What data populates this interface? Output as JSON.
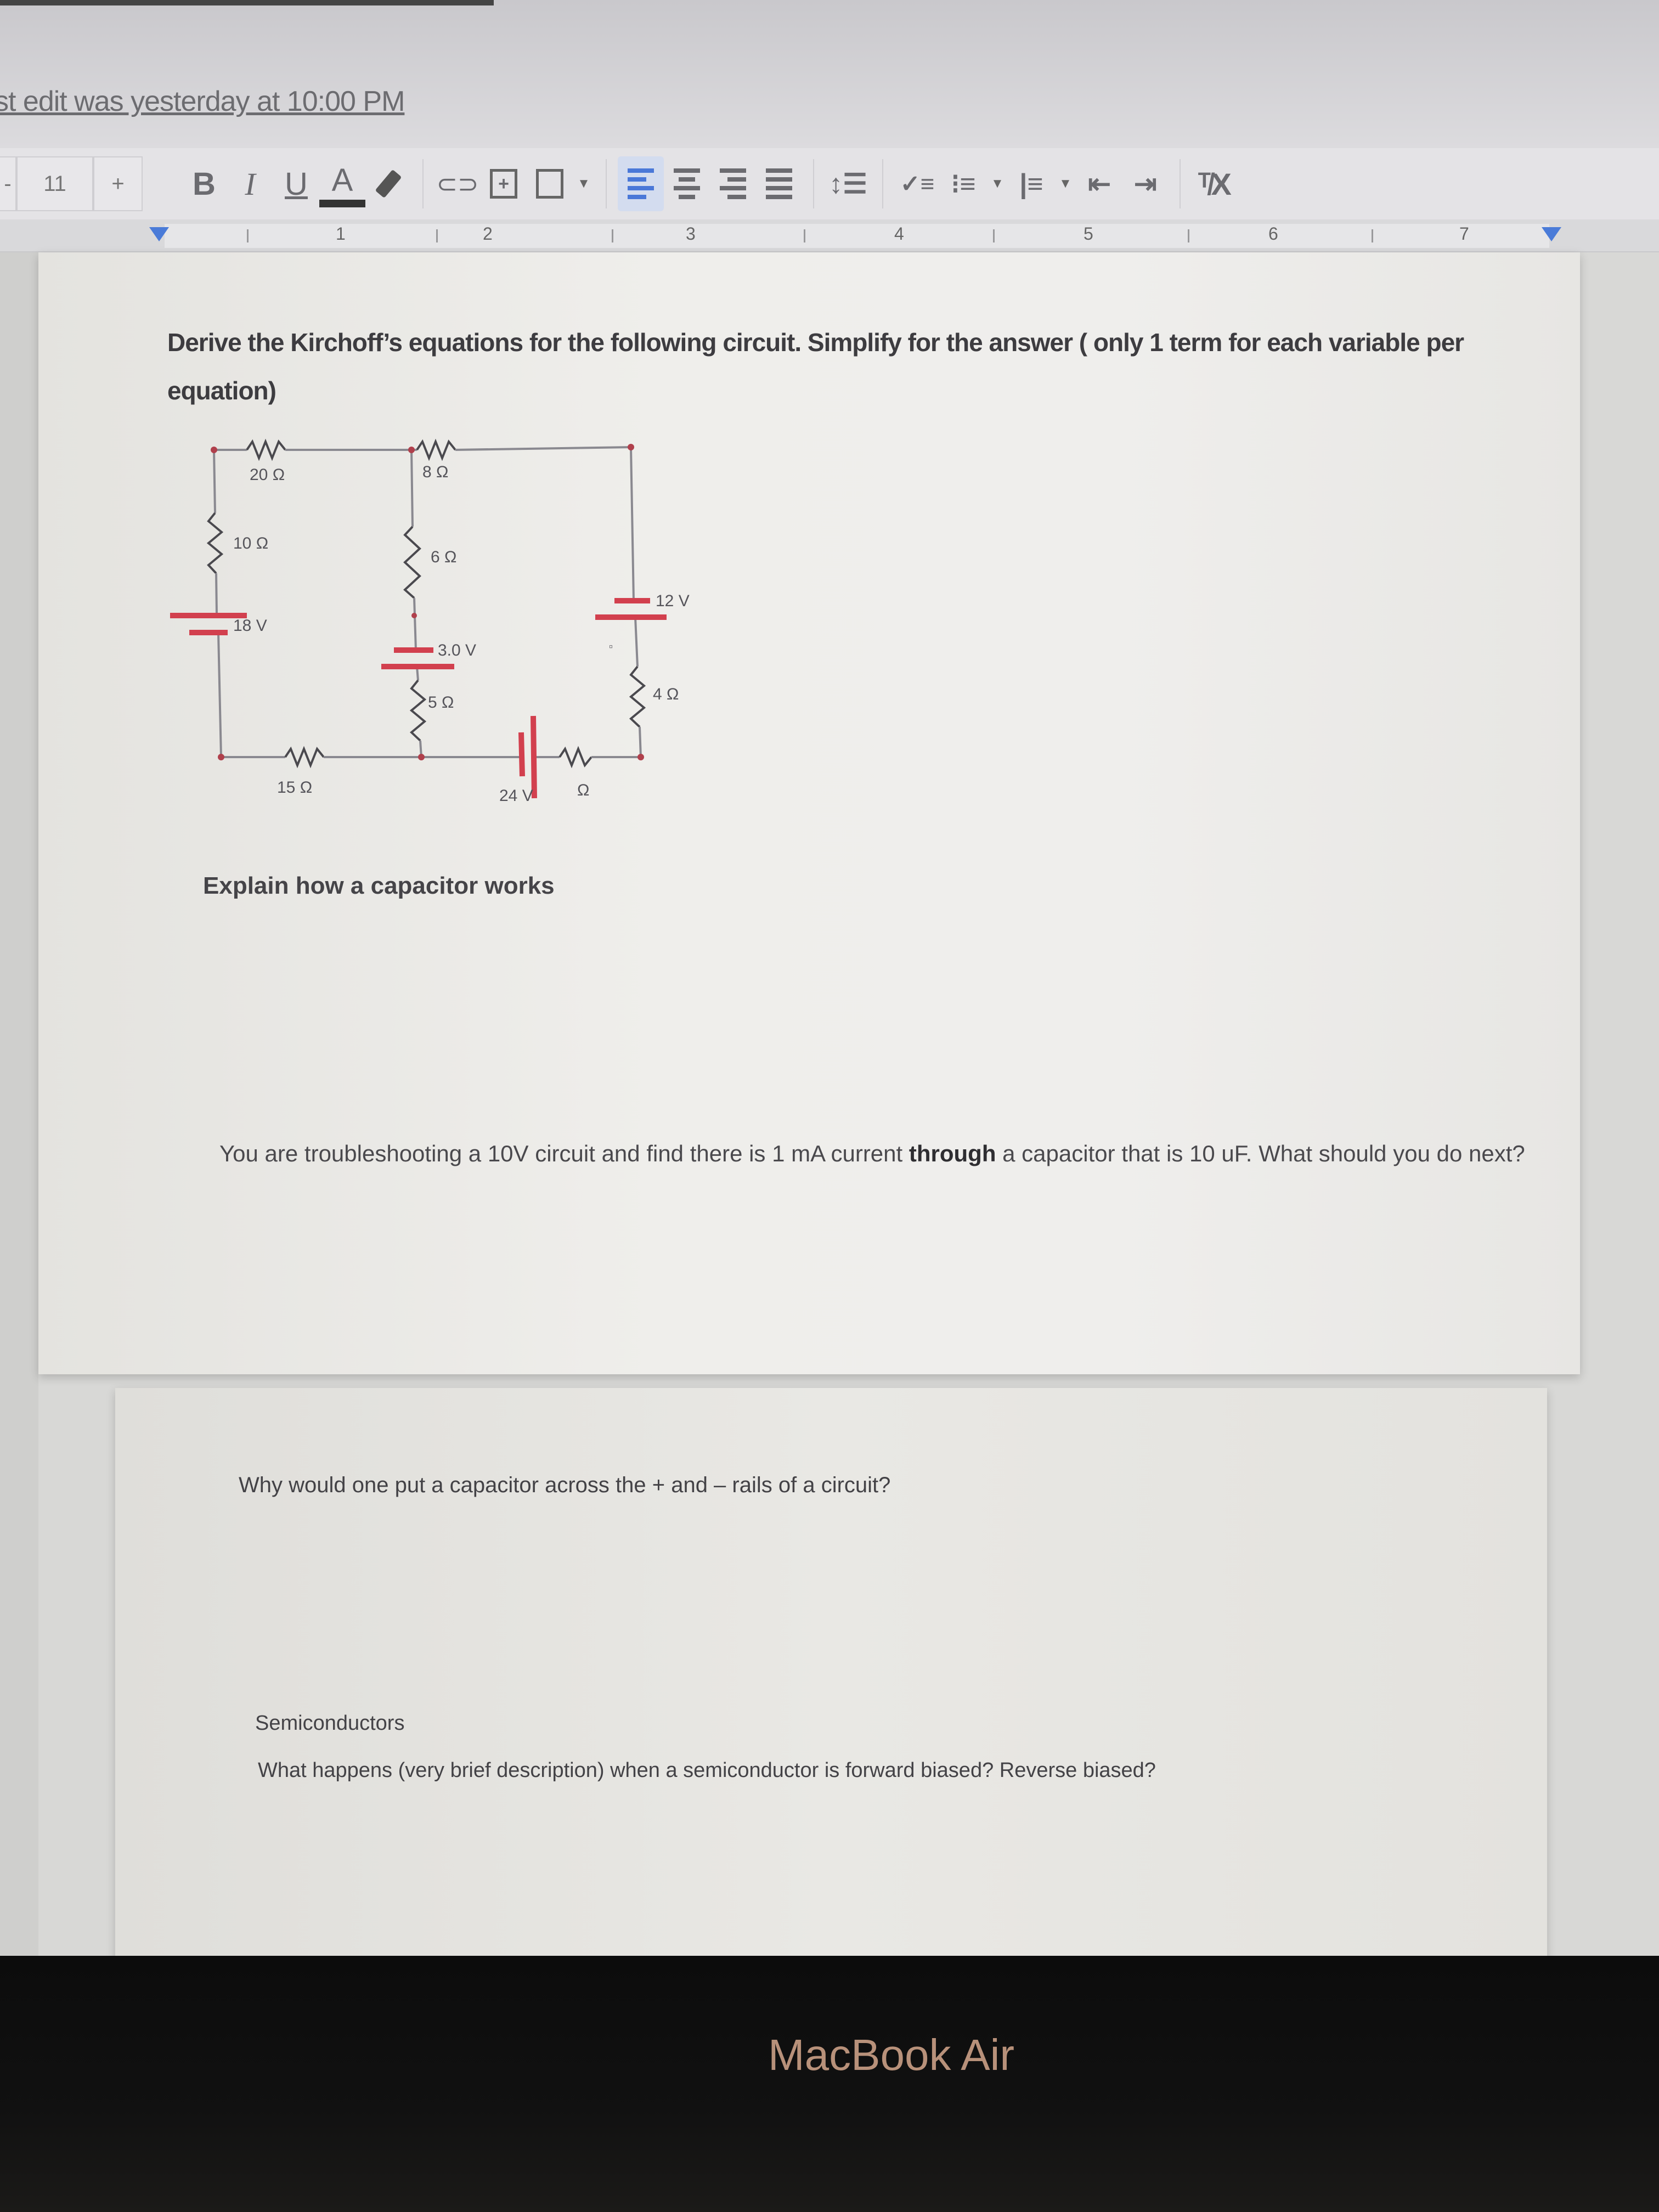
{
  "header": {
    "last_edit": "st edit was yesterday at 10:00 PM"
  },
  "toolbar": {
    "font_size": "11",
    "font_size_increase": "+",
    "buttons": [
      {
        "name": "bold-button",
        "label": "B"
      },
      {
        "name": "italic-button",
        "label": "I"
      },
      {
        "name": "underline-button",
        "label": "U"
      },
      {
        "name": "text-color-button",
        "label": "A"
      }
    ],
    "icons": [
      "highlight-icon",
      "link-icon",
      "comment-icon",
      "image-icon",
      "align-left-icon",
      "align-center-icon",
      "align-right-icon",
      "justify-icon",
      "line-spacing-icon",
      "checklist-icon",
      "bulleted-list-icon",
      "numbered-list-icon",
      "decrease-indent-icon",
      "increase-indent-icon",
      "clear-formatting-icon"
    ],
    "active_alignment": "left",
    "accent_color": "#4a78d8"
  },
  "ruler": {
    "numbers": [
      "1",
      "2",
      "3",
      "4",
      "5",
      "6",
      "7"
    ]
  },
  "document": {
    "q1": "Derive the Kirchoff’s equations for the following circuit. Simplify for the answer ( only 1 term for each variable per equation)",
    "circuit": {
      "r_top_left": "20 Ω",
      "r_top_right": "8 Ω",
      "r_left": "10 Ω",
      "v_left": "18 V",
      "r_mid_upper": "6 Ω",
      "v_mid": "3.0 V",
      "r_mid_lower": "5 Ω",
      "v_right": "12 V",
      "r_right": "4 Ω",
      "r_bottom_left": "15 Ω",
      "v_bottom": "24 V",
      "r_bottom_right": "Ω",
      "stray_mark": "▫",
      "wire_color": "#8a8990",
      "source_color": "#d2404e"
    },
    "q2": "Explain how a capacitor works",
    "q3_part1": "You are troubleshooting a 10V circuit and find there is 1 mA current ",
    "q3_bold": "through",
    "q3_part2": " a capacitor that is 10 uF. What should you do next?",
    "q4": "Why would one put a capacitor across the + and – rails of a circuit?",
    "q5_heading": "Semiconductors",
    "q5": "What happens (very brief description) when a semiconductor is forward biased? Reverse biased?"
  },
  "bezel": {
    "label": "MacBook Air"
  }
}
